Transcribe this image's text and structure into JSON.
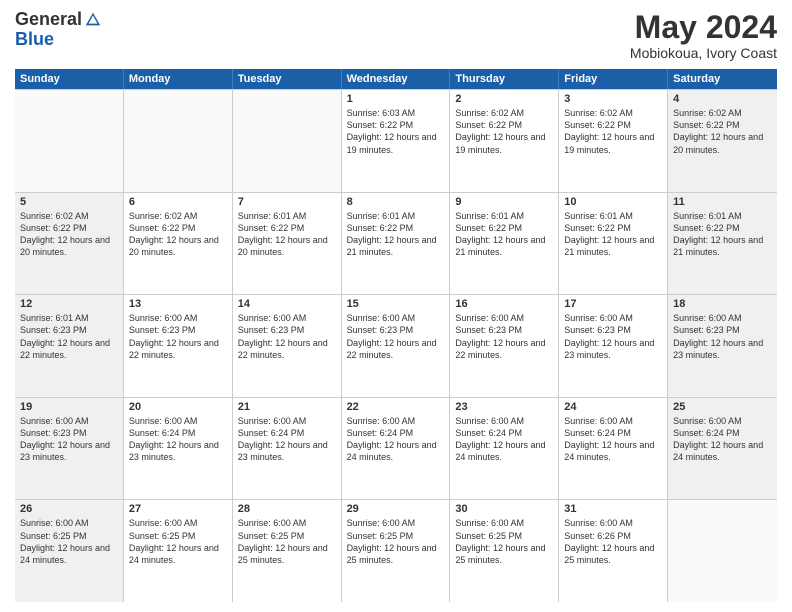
{
  "header": {
    "logo_general": "General",
    "logo_blue": "Blue",
    "month": "May 2024",
    "location": "Mobiokoua, Ivory Coast"
  },
  "weekdays": [
    "Sunday",
    "Monday",
    "Tuesday",
    "Wednesday",
    "Thursday",
    "Friday",
    "Saturday"
  ],
  "rows": [
    [
      {
        "day": "",
        "info": "",
        "empty": true
      },
      {
        "day": "",
        "info": "",
        "empty": true
      },
      {
        "day": "",
        "info": "",
        "empty": true
      },
      {
        "day": "1",
        "info": "Sunrise: 6:03 AM\nSunset: 6:22 PM\nDaylight: 12 hours\nand 19 minutes."
      },
      {
        "day": "2",
        "info": "Sunrise: 6:02 AM\nSunset: 6:22 PM\nDaylight: 12 hours\nand 19 minutes."
      },
      {
        "day": "3",
        "info": "Sunrise: 6:02 AM\nSunset: 6:22 PM\nDaylight: 12 hours\nand 19 minutes."
      },
      {
        "day": "4",
        "info": "Sunrise: 6:02 AM\nSunset: 6:22 PM\nDaylight: 12 hours\nand 20 minutes.",
        "weekend": true
      }
    ],
    [
      {
        "day": "5",
        "info": "Sunrise: 6:02 AM\nSunset: 6:22 PM\nDaylight: 12 hours\nand 20 minutes.",
        "weekend": true
      },
      {
        "day": "6",
        "info": "Sunrise: 6:02 AM\nSunset: 6:22 PM\nDaylight: 12 hours\nand 20 minutes."
      },
      {
        "day": "7",
        "info": "Sunrise: 6:01 AM\nSunset: 6:22 PM\nDaylight: 12 hours\nand 20 minutes."
      },
      {
        "day": "8",
        "info": "Sunrise: 6:01 AM\nSunset: 6:22 PM\nDaylight: 12 hours\nand 21 minutes."
      },
      {
        "day": "9",
        "info": "Sunrise: 6:01 AM\nSunset: 6:22 PM\nDaylight: 12 hours\nand 21 minutes."
      },
      {
        "day": "10",
        "info": "Sunrise: 6:01 AM\nSunset: 6:22 PM\nDaylight: 12 hours\nand 21 minutes."
      },
      {
        "day": "11",
        "info": "Sunrise: 6:01 AM\nSunset: 6:22 PM\nDaylight: 12 hours\nand 21 minutes.",
        "weekend": true
      }
    ],
    [
      {
        "day": "12",
        "info": "Sunrise: 6:01 AM\nSunset: 6:23 PM\nDaylight: 12 hours\nand 22 minutes.",
        "weekend": true
      },
      {
        "day": "13",
        "info": "Sunrise: 6:00 AM\nSunset: 6:23 PM\nDaylight: 12 hours\nand 22 minutes."
      },
      {
        "day": "14",
        "info": "Sunrise: 6:00 AM\nSunset: 6:23 PM\nDaylight: 12 hours\nand 22 minutes."
      },
      {
        "day": "15",
        "info": "Sunrise: 6:00 AM\nSunset: 6:23 PM\nDaylight: 12 hours\nand 22 minutes."
      },
      {
        "day": "16",
        "info": "Sunrise: 6:00 AM\nSunset: 6:23 PM\nDaylight: 12 hours\nand 22 minutes."
      },
      {
        "day": "17",
        "info": "Sunrise: 6:00 AM\nSunset: 6:23 PM\nDaylight: 12 hours\nand 23 minutes."
      },
      {
        "day": "18",
        "info": "Sunrise: 6:00 AM\nSunset: 6:23 PM\nDaylight: 12 hours\nand 23 minutes.",
        "weekend": true
      }
    ],
    [
      {
        "day": "19",
        "info": "Sunrise: 6:00 AM\nSunset: 6:23 PM\nDaylight: 12 hours\nand 23 minutes.",
        "weekend": true
      },
      {
        "day": "20",
        "info": "Sunrise: 6:00 AM\nSunset: 6:24 PM\nDaylight: 12 hours\nand 23 minutes."
      },
      {
        "day": "21",
        "info": "Sunrise: 6:00 AM\nSunset: 6:24 PM\nDaylight: 12 hours\nand 23 minutes."
      },
      {
        "day": "22",
        "info": "Sunrise: 6:00 AM\nSunset: 6:24 PM\nDaylight: 12 hours\nand 24 minutes."
      },
      {
        "day": "23",
        "info": "Sunrise: 6:00 AM\nSunset: 6:24 PM\nDaylight: 12 hours\nand 24 minutes."
      },
      {
        "day": "24",
        "info": "Sunrise: 6:00 AM\nSunset: 6:24 PM\nDaylight: 12 hours\nand 24 minutes."
      },
      {
        "day": "25",
        "info": "Sunrise: 6:00 AM\nSunset: 6:24 PM\nDaylight: 12 hours\nand 24 minutes.",
        "weekend": true
      }
    ],
    [
      {
        "day": "26",
        "info": "Sunrise: 6:00 AM\nSunset: 6:25 PM\nDaylight: 12 hours\nand 24 minutes.",
        "weekend": true
      },
      {
        "day": "27",
        "info": "Sunrise: 6:00 AM\nSunset: 6:25 PM\nDaylight: 12 hours\nand 24 minutes."
      },
      {
        "day": "28",
        "info": "Sunrise: 6:00 AM\nSunset: 6:25 PM\nDaylight: 12 hours\nand 25 minutes."
      },
      {
        "day": "29",
        "info": "Sunrise: 6:00 AM\nSunset: 6:25 PM\nDaylight: 12 hours\nand 25 minutes."
      },
      {
        "day": "30",
        "info": "Sunrise: 6:00 AM\nSunset: 6:25 PM\nDaylight: 12 hours\nand 25 minutes."
      },
      {
        "day": "31",
        "info": "Sunrise: 6:00 AM\nSunset: 6:26 PM\nDaylight: 12 hours\nand 25 minutes."
      },
      {
        "day": "",
        "info": "",
        "empty": true
      }
    ]
  ]
}
